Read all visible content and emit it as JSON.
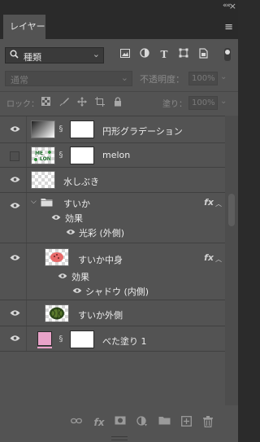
{
  "window": {
    "collapse_label": "««",
    "close_label": "×",
    "tab_label": "レイヤー",
    "panel_menu_label": "≡"
  },
  "filter": {
    "kind_label": "種類",
    "icons": [
      "image-filter-icon",
      "adjustment-filter-icon",
      "type-filter-icon",
      "shape-filter-icon",
      "smart-object-filter-icon"
    ]
  },
  "blend": {
    "mode": "通常",
    "opacity_label": "不透明度：",
    "opacity_value": "100%",
    "lock_label": "ロック：",
    "fill_label": "塗り：",
    "fill_value": "100%"
  },
  "layers": [
    {
      "name": "円形グラデーション",
      "visible": true,
      "type": "gradient-fill"
    },
    {
      "name": "melon",
      "visible": false,
      "type": "pattern-fill"
    },
    {
      "name": "水しぶき",
      "visible": true,
      "type": "pixel"
    },
    {
      "name": "すいか",
      "visible": true,
      "type": "group",
      "fx": "fx",
      "effects_label": "効果",
      "effects": [
        "光彩 (外側)"
      ]
    },
    {
      "name": "すいか中身",
      "visible": true,
      "type": "pixel",
      "fx": "fx",
      "effects_label": "効果",
      "effects": [
        "シャドウ (内側)"
      ]
    },
    {
      "name": "すいか外側",
      "visible": true,
      "type": "pixel"
    },
    {
      "name": "べた塗り 1",
      "visible": true,
      "type": "solid-fill"
    }
  ],
  "bottom": {
    "fx_label": "fx"
  },
  "colors": {
    "panel_bg": "#535353",
    "solid_fill_swatch": "#e9a3c9"
  }
}
